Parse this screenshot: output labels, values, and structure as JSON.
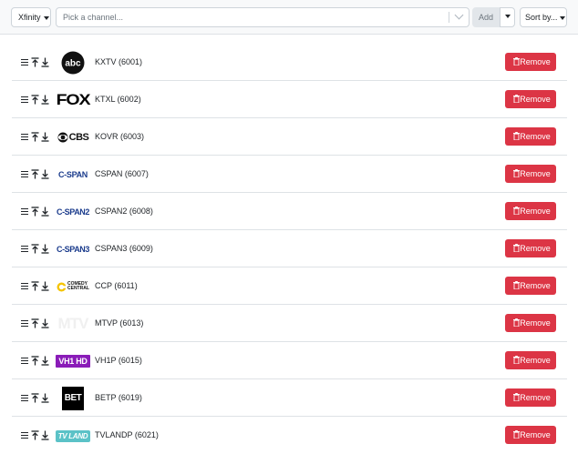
{
  "toolbar": {
    "provider_label": "Xfinity",
    "channel_placeholder": "Pick a channel...",
    "add_label": "Add",
    "sort_label": "Sort by..."
  },
  "channels": [
    {
      "name": "KXTV (6001)",
      "logo": "ABC",
      "remove_label": "Remove"
    },
    {
      "name": "KTXL (6002)",
      "logo": "FOX",
      "remove_label": "Remove"
    },
    {
      "name": "KOVR (6003)",
      "logo": "CBS",
      "remove_label": "Remove"
    },
    {
      "name": "CSPAN (6007)",
      "logo": "C-SPAN",
      "remove_label": "Remove"
    },
    {
      "name": "CSPAN2 (6008)",
      "logo": "C-SPAN2",
      "remove_label": "Remove"
    },
    {
      "name": "CSPAN3 (6009)",
      "logo": "C-SPAN3",
      "remove_label": "Remove"
    },
    {
      "name": "CCP (6011)",
      "logo": "COMEDY CENTRAL",
      "remove_label": "Remove"
    },
    {
      "name": "MTVP (6013)",
      "logo": "MTV",
      "remove_label": "Remove"
    },
    {
      "name": "VH1P (6015)",
      "logo": "VH1 HD",
      "remove_label": "Remove"
    },
    {
      "name": "BETP (6019)",
      "logo": "BET",
      "remove_label": "Remove"
    },
    {
      "name": "TVLANDP (6021)",
      "logo": "TV LAND",
      "remove_label": "Remove"
    }
  ],
  "colors": {
    "remove": "#dc3545",
    "toolbar_bg": "#f8f9fa",
    "cspan_blue": "#1a3b8c",
    "vh1_purple": "#8a1cb8",
    "tvland_teal": "#5bc2c7"
  }
}
